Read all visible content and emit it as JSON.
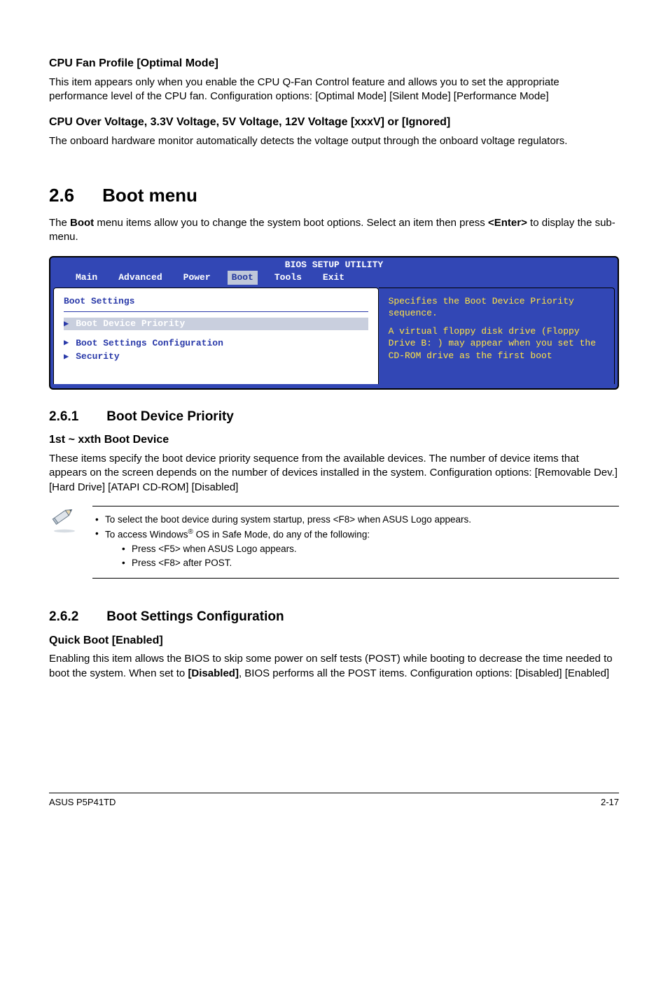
{
  "sec1": {
    "h1": "CPU Fan Profile [Optimal Mode]",
    "p1": "This item appears only when you enable the CPU Q-Fan Control feature and allows you to set the appropriate performance level of the CPU fan. Configuration options: [Optimal Mode] [Silent Mode] [Performance Mode]",
    "h2": "CPU Over Voltage, 3.3V Voltage, 5V Voltage, 12V Voltage [xxxV] or [Ignored]",
    "p2": "The onboard hardware monitor automatically detects the voltage output through the onboard voltage regulators."
  },
  "boot": {
    "num": "2.6",
    "title": "Boot menu",
    "intro_a": "The ",
    "intro_bold": "Boot",
    "intro_b": " menu items allow you to change the system boot options. Select an item then press ",
    "intro_bold2": "<Enter>",
    "intro_c": " to display the sub-menu."
  },
  "bios": {
    "title": "BIOS SETUP UTILITY",
    "tabs": [
      "Main",
      "Advanced",
      "Power",
      "Boot",
      "Tools",
      "Exit"
    ],
    "selected_tab": "Boot",
    "left_heading": "Boot Settings",
    "items": [
      {
        "label": "Boot Device Priority",
        "selected": true
      },
      {
        "label": "Boot Settings Configuration",
        "selected": false
      },
      {
        "label": "Security",
        "selected": false
      }
    ],
    "help1": "Specifies the Boot Device Priority sequence.",
    "help2": "A virtual floppy disk drive (Floppy Drive B: ) may appear when you set the CD-ROM drive as the first boot"
  },
  "s261": {
    "num": "2.6.1",
    "title": "Boot Device Priority",
    "h": "1st ~ xxth Boot Device",
    "p": "These items specify the boot device priority sequence from the available devices. The number of device items that appears on the screen depends on the number of devices installed in the system. Configuration options: [Removable Dev.] [Hard Drive] [ATAPI CD-ROM] [Disabled]"
  },
  "note": {
    "b1": "To select the boot device during system startup, press <F8> when ASUS Logo appears.",
    "b2a": "To access Windows",
    "b2b": " OS in Safe Mode, do any of the following:",
    "s1": "Press <F5> when ASUS Logo appears.",
    "s2": "Press <F8> after POST."
  },
  "s262": {
    "num": "2.6.2",
    "title": "Boot Settings Configuration",
    "h": "Quick Boot [Enabled]",
    "p_a": "Enabling this item allows the BIOS to skip some power on self tests (POST) while booting to decrease the time needed to boot the system. When set to ",
    "p_bold": "[Disabled]",
    "p_b": ", BIOS performs all the POST items. Configuration options: [Disabled] [Enabled]"
  },
  "footer": {
    "left": "ASUS P5P41TD",
    "right": "2-17"
  }
}
